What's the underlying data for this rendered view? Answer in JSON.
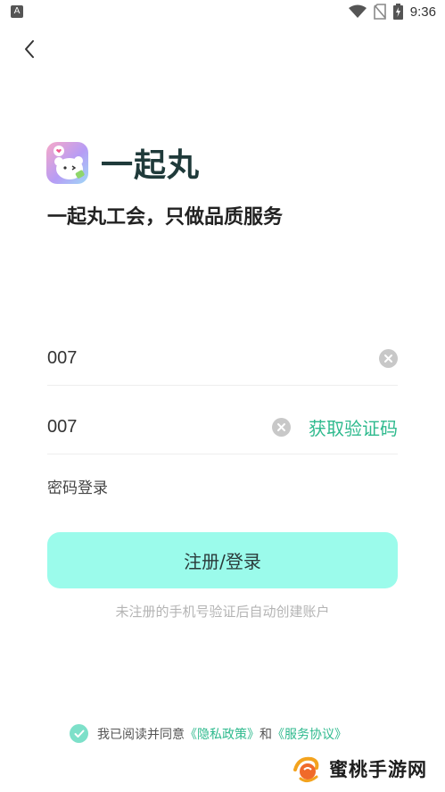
{
  "status_bar": {
    "left_icon": "A",
    "time": "9:36",
    "icons": [
      "wifi-icon",
      "no-sim-icon",
      "battery-charging-icon"
    ]
  },
  "header": {
    "back_icon": "chevron-left-icon"
  },
  "brand": {
    "app_name": "一起丸",
    "slogan": "一起丸工会，只做品质服务"
  },
  "form": {
    "phone_value": "007",
    "code_value": "007",
    "get_code_label": "获取验证码",
    "password_login_label": "密码登录",
    "submit_label": "注册/登录",
    "hint": "未注册的手机号验证后自动创建账户"
  },
  "agreement": {
    "prefix": "我已阅读并同意",
    "privacy_link": "《隐私政策》",
    "conjunction": "和",
    "service_link": "《服务协议》",
    "checked": true
  },
  "watermark": {
    "text": "蜜桃手游网"
  },
  "colors": {
    "accent": "#2fba8e",
    "button_bg": "#9bfbeb",
    "check_bg": "#7de0c9"
  }
}
